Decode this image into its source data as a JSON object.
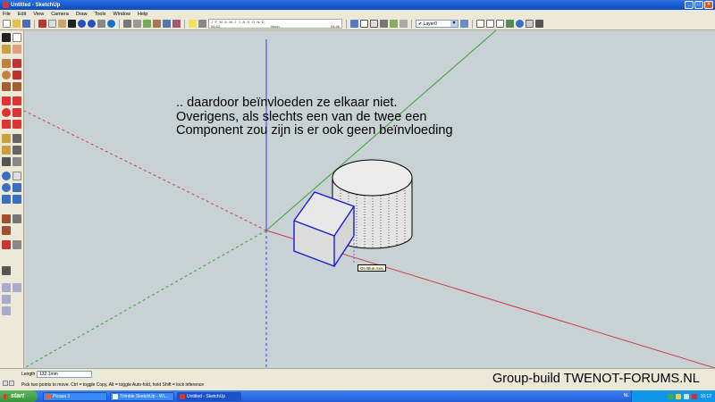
{
  "window": {
    "title": "Untitled - SketchUp"
  },
  "menu": [
    "File",
    "Edit",
    "View",
    "Camera",
    "Draw",
    "Tools",
    "Window",
    "Help"
  ],
  "shadow_settings": {
    "months": [
      "J",
      "F",
      "M",
      "A",
      "M",
      "J",
      "J",
      "A",
      "S",
      "O",
      "N",
      "D"
    ],
    "time_left": "06:43",
    "time_mid": "Noon",
    "time_right": "04:46"
  },
  "layer": {
    "value": "Layer0"
  },
  "viewport": {
    "note": ".. daardoor beïnvloeden ze elkaar niet. Overigens, als slechts een van de twee een Component zou zijn is er ook geen beïnvloeding",
    "tooltip": "On Blue Axis",
    "colors": {
      "background": "#c8d1d3",
      "blue_axis": "#3a3cf0",
      "green_axis": "#3fa03f",
      "red_axis": "#c84040",
      "selection": "#1b1bd6"
    }
  },
  "status": {
    "length_label": "Length",
    "length_value": "132.1mm",
    "hint": "Pick two points to move.  Ctrl = toggle Copy, Alt = toggle Auto-fold, hold Shift = lock inference"
  },
  "watermark": "Group-build TWENOT-FORUMS.NL",
  "taskbar": {
    "start": "start",
    "items": [
      {
        "label": "Picasa 3",
        "icon": "picasa-icon",
        "color": "#d64"
      },
      {
        "label": "Trimble SketchUp - Wi...",
        "icon": "browser-icon",
        "color": "#fff"
      },
      {
        "label": "Untitled - SketchUp",
        "icon": "sketchup-icon",
        "color": "#d33"
      }
    ],
    "language": "NL",
    "clock": "10:12"
  }
}
